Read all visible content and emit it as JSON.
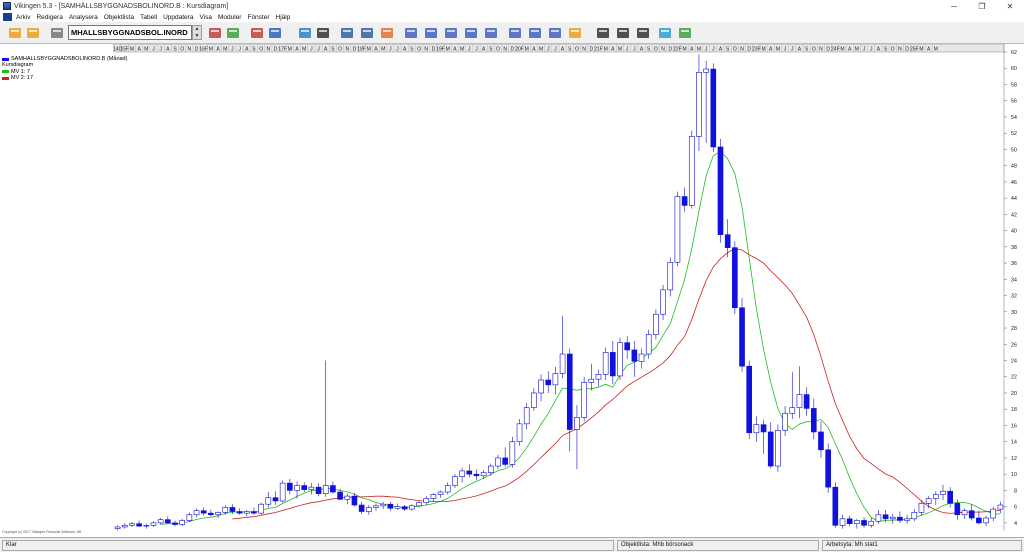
{
  "window": {
    "title": "Vikingen 5.3 - [SAMHÄLLSBYGGNADSBOLINORD.B : Kursdiagram]",
    "min_glyph": "─",
    "restore_glyph": "❐",
    "close_glyph": "✕"
  },
  "menu": [
    "Arkiv",
    "Redigera",
    "Analysera",
    "Objektlista",
    "Tabell",
    "Uppdatera",
    "Visa",
    "Moduler",
    "Fönster",
    "Hjälp"
  ],
  "toolbar": {
    "symbol_value": "MHALLSBYGGNADSBOL.INORD",
    "spin_up": "▲",
    "spin_down": "▼",
    "icons": [
      "open-folder-icon",
      "save-icon",
      "objectlist-icon",
      "next-icon",
      "prev-icon",
      "signal-icon",
      "info-icon",
      "refresh-icon",
      "camera-icon",
      "print-icon",
      "printer-icon",
      "color-icon",
      "window1-icon",
      "window2-icon",
      "window3-icon",
      "window4-icon",
      "grid-icon",
      "window5-icon",
      "window6-icon",
      "table-icon",
      "edit-icon",
      "candle-icon",
      "bars-icon",
      "curve-icon",
      "globe-icon",
      "module-icon"
    ]
  },
  "legend": [
    {
      "label": "SAMHALLSBYGGNADSBOLINORD.B (Månad)",
      "color": "#1010e0"
    },
    {
      "label": "Kursdiagram",
      "color": ""
    },
    {
      "label": "MV 1: 7",
      "color": "#22bb22"
    },
    {
      "label": "MV 2: 17",
      "color": "#cc2222"
    }
  ],
  "copyright": "Copyright (c) 2017 Vikingen Financial Software, AB",
  "status": {
    "left": "Klar",
    "objectlist": "Objektlista: Mhb börsonack",
    "worksheet": "Arbetsyta: Mh stat1"
  },
  "chart_data": {
    "type": "candlestick",
    "timeframe": "monthly",
    "ylim": [
      3,
      62
    ],
    "y_ticks": [
      4,
      6,
      8,
      10,
      12,
      14,
      16,
      18,
      20,
      22,
      24,
      26,
      28,
      30,
      32,
      34,
      36,
      38,
      40,
      42,
      44,
      46,
      48,
      50,
      52,
      54,
      56,
      58,
      60,
      62
    ],
    "x_axis_labels": [
      "14D",
      "15F",
      "M",
      "A",
      "M",
      "J",
      "J",
      "A",
      "S",
      "O",
      "N",
      "D",
      "16F",
      "M",
      "A",
      "M",
      "J",
      "J",
      "A",
      "S",
      "O",
      "N",
      "D",
      "17F",
      "M",
      "A",
      "M",
      "J",
      "J",
      "A",
      "S",
      "O",
      "N",
      "D",
      "18F",
      "M",
      "A",
      "M",
      "J",
      "J",
      "A",
      "S",
      "O",
      "N",
      "D",
      "19F",
      "M",
      "A",
      "M",
      "J",
      "J",
      "A",
      "S",
      "O",
      "N",
      "D",
      "20F",
      "M",
      "A",
      "M",
      "J",
      "J",
      "A",
      "S",
      "O",
      "N",
      "D",
      "21F",
      "M",
      "A",
      "M",
      "J",
      "J",
      "A",
      "S",
      "O",
      "N",
      "D",
      "22F",
      "M",
      "A",
      "M",
      "J",
      "J",
      "A",
      "S",
      "O",
      "N",
      "D",
      "23F",
      "M",
      "A",
      "M",
      "J",
      "J",
      "A",
      "S",
      "O",
      "N",
      "D",
      "24F",
      "M",
      "A",
      "M",
      "J",
      "J",
      "A",
      "S",
      "O",
      "N",
      "D",
      "25F",
      "M",
      "A",
      "M"
    ],
    "candles": [
      {
        "o": 3.3,
        "h": 3.7,
        "l": 3.1,
        "c": 3.5
      },
      {
        "o": 3.5,
        "h": 4.0,
        "l": 3.3,
        "c": 3.7
      },
      {
        "o": 3.7,
        "h": 4.1,
        "l": 3.5,
        "c": 3.9
      },
      {
        "o": 3.9,
        "h": 4.3,
        "l": 3.5,
        "c": 3.6
      },
      {
        "o": 3.6,
        "h": 3.9,
        "l": 3.3,
        "c": 3.7
      },
      {
        "o": 3.7,
        "h": 4.2,
        "l": 3.5,
        "c": 4.0
      },
      {
        "o": 4.0,
        "h": 4.6,
        "l": 3.8,
        "c": 4.4
      },
      {
        "o": 4.4,
        "h": 4.8,
        "l": 3.9,
        "c": 4.0
      },
      {
        "o": 4.0,
        "h": 4.3,
        "l": 3.6,
        "c": 3.8
      },
      {
        "o": 3.8,
        "h": 4.5,
        "l": 3.6,
        "c": 4.3
      },
      {
        "o": 4.3,
        "h": 5.3,
        "l": 4.1,
        "c": 5.0
      },
      {
        "o": 5.0,
        "h": 5.8,
        "l": 4.7,
        "c": 5.5
      },
      {
        "o": 5.5,
        "h": 5.9,
        "l": 4.9,
        "c": 5.2
      },
      {
        "o": 5.2,
        "h": 5.6,
        "l": 4.8,
        "c": 5.0
      },
      {
        "o": 5.0,
        "h": 5.4,
        "l": 4.6,
        "c": 5.3
      },
      {
        "o": 5.3,
        "h": 6.2,
        "l": 5.0,
        "c": 5.9
      },
      {
        "o": 5.9,
        "h": 6.3,
        "l": 5.1,
        "c": 5.4
      },
      {
        "o": 5.4,
        "h": 5.8,
        "l": 5.0,
        "c": 5.2
      },
      {
        "o": 5.2,
        "h": 5.6,
        "l": 4.8,
        "c": 5.4
      },
      {
        "o": 5.4,
        "h": 5.9,
        "l": 5.0,
        "c": 5.2
      },
      {
        "o": 5.2,
        "h": 6.5,
        "l": 5.0,
        "c": 6.3
      },
      {
        "o": 6.3,
        "h": 7.8,
        "l": 5.9,
        "c": 7.1
      },
      {
        "o": 7.1,
        "h": 7.9,
        "l": 6.2,
        "c": 6.7
      },
      {
        "o": 6.7,
        "h": 9.2,
        "l": 6.5,
        "c": 8.9
      },
      {
        "o": 8.9,
        "h": 9.4,
        "l": 7.5,
        "c": 8.0
      },
      {
        "o": 8.0,
        "h": 9.1,
        "l": 7.0,
        "c": 8.6
      },
      {
        "o": 8.6,
        "h": 9.0,
        "l": 7.8,
        "c": 8.1
      },
      {
        "o": 8.1,
        "h": 8.9,
        "l": 7.5,
        "c": 8.4
      },
      {
        "o": 8.4,
        "h": 8.9,
        "l": 7.3,
        "c": 7.6
      },
      {
        "o": 7.6,
        "h": 24.0,
        "l": 7.2,
        "c": 8.6
      },
      {
        "o": 8.6,
        "h": 9.1,
        "l": 7.6,
        "c": 7.8
      },
      {
        "o": 7.8,
        "h": 8.2,
        "l": 6.8,
        "c": 6.9
      },
      {
        "o": 6.9,
        "h": 7.6,
        "l": 6.3,
        "c": 7.3
      },
      {
        "o": 7.3,
        "h": 7.7,
        "l": 6.0,
        "c": 6.2
      },
      {
        "o": 6.2,
        "h": 6.6,
        "l": 5.1,
        "c": 5.4
      },
      {
        "o": 5.4,
        "h": 6.2,
        "l": 5.0,
        "c": 5.9
      },
      {
        "o": 5.9,
        "h": 6.4,
        "l": 5.5,
        "c": 6.1
      },
      {
        "o": 6.1,
        "h": 6.6,
        "l": 5.7,
        "c": 6.3
      },
      {
        "o": 6.3,
        "h": 6.6,
        "l": 5.5,
        "c": 5.8
      },
      {
        "o": 5.8,
        "h": 6.4,
        "l": 5.6,
        "c": 6.0
      },
      {
        "o": 6.0,
        "h": 6.2,
        "l": 5.5,
        "c": 5.7
      },
      {
        "o": 5.7,
        "h": 6.3,
        "l": 5.5,
        "c": 6.1
      },
      {
        "o": 6.1,
        "h": 6.7,
        "l": 5.9,
        "c": 6.5
      },
      {
        "o": 6.5,
        "h": 7.3,
        "l": 6.2,
        "c": 7.0
      },
      {
        "o": 7.0,
        "h": 7.7,
        "l": 6.6,
        "c": 7.5
      },
      {
        "o": 7.5,
        "h": 8.0,
        "l": 7.1,
        "c": 7.8
      },
      {
        "o": 7.8,
        "h": 9.0,
        "l": 7.5,
        "c": 8.6
      },
      {
        "o": 8.6,
        "h": 10.0,
        "l": 8.3,
        "c": 9.7
      },
      {
        "o": 9.7,
        "h": 10.8,
        "l": 9.0,
        "c": 10.4
      },
      {
        "o": 10.4,
        "h": 11.2,
        "l": 9.6,
        "c": 10.0
      },
      {
        "o": 10.0,
        "h": 10.6,
        "l": 9.3,
        "c": 9.8
      },
      {
        "o": 9.8,
        "h": 10.5,
        "l": 9.4,
        "c": 10.2
      },
      {
        "o": 10.2,
        "h": 11.3,
        "l": 9.8,
        "c": 11.0
      },
      {
        "o": 11.0,
        "h": 12.4,
        "l": 10.6,
        "c": 12.0
      },
      {
        "o": 12.0,
        "h": 13.3,
        "l": 10.9,
        "c": 11.2
      },
      {
        "o": 11.2,
        "h": 14.6,
        "l": 10.8,
        "c": 14.0
      },
      {
        "o": 14.0,
        "h": 16.8,
        "l": 13.5,
        "c": 16.2
      },
      {
        "o": 16.2,
        "h": 18.8,
        "l": 15.5,
        "c": 18.2
      },
      {
        "o": 18.2,
        "h": 20.6,
        "l": 17.8,
        "c": 20.0
      },
      {
        "o": 20.0,
        "h": 22.3,
        "l": 19.0,
        "c": 21.6
      },
      {
        "o": 21.6,
        "h": 22.7,
        "l": 20.0,
        "c": 21.0
      },
      {
        "o": 21.0,
        "h": 23.2,
        "l": 19.8,
        "c": 22.4
      },
      {
        "o": 22.4,
        "h": 29.5,
        "l": 21.8,
        "c": 24.8
      },
      {
        "o": 24.8,
        "h": 25.5,
        "l": 12.8,
        "c": 15.5
      },
      {
        "o": 15.5,
        "h": 18.5,
        "l": 10.6,
        "c": 17.0
      },
      {
        "o": 17.0,
        "h": 22.0,
        "l": 16.5,
        "c": 21.3
      },
      {
        "o": 21.3,
        "h": 23.6,
        "l": 20.3,
        "c": 21.7
      },
      {
        "o": 21.7,
        "h": 22.9,
        "l": 20.8,
        "c": 22.3
      },
      {
        "o": 22.3,
        "h": 25.6,
        "l": 21.6,
        "c": 25.0
      },
      {
        "o": 25.0,
        "h": 26.4,
        "l": 21.1,
        "c": 22.1
      },
      {
        "o": 22.1,
        "h": 26.8,
        "l": 21.6,
        "c": 26.2
      },
      {
        "o": 26.2,
        "h": 27.0,
        "l": 24.2,
        "c": 25.3
      },
      {
        "o": 25.3,
        "h": 26.4,
        "l": 22.0,
        "c": 23.9
      },
      {
        "o": 23.9,
        "h": 25.5,
        "l": 23.0,
        "c": 24.8
      },
      {
        "o": 24.8,
        "h": 27.8,
        "l": 24.2,
        "c": 27.2
      },
      {
        "o": 27.2,
        "h": 30.3,
        "l": 26.6,
        "c": 29.7
      },
      {
        "o": 29.7,
        "h": 33.3,
        "l": 29.0,
        "c": 32.7
      },
      {
        "o": 32.7,
        "h": 36.7,
        "l": 31.9,
        "c": 36.1
      },
      {
        "o": 36.1,
        "h": 44.8,
        "l": 35.6,
        "c": 44.2
      },
      {
        "o": 44.2,
        "h": 45.3,
        "l": 42.3,
        "c": 43.1
      },
      {
        "o": 43.1,
        "h": 52.3,
        "l": 42.7,
        "c": 51.6
      },
      {
        "o": 51.6,
        "h": 61.7,
        "l": 49.8,
        "c": 59.5
      },
      {
        "o": 59.5,
        "h": 60.9,
        "l": 50.8,
        "c": 59.9
      },
      {
        "o": 59.9,
        "h": 60.6,
        "l": 49.7,
        "c": 50.3
      },
      {
        "o": 50.3,
        "h": 51.3,
        "l": 38.5,
        "c": 39.5
      },
      {
        "o": 39.5,
        "h": 41.4,
        "l": 36.7,
        "c": 37.9
      },
      {
        "o": 37.9,
        "h": 38.7,
        "l": 29.7,
        "c": 30.5
      },
      {
        "o": 30.5,
        "h": 31.7,
        "l": 22.6,
        "c": 23.3
      },
      {
        "o": 23.3,
        "h": 24.0,
        "l": 14.3,
        "c": 15.1
      },
      {
        "o": 15.1,
        "h": 17.1,
        "l": 14.0,
        "c": 16.1
      },
      {
        "o": 16.1,
        "h": 16.7,
        "l": 12.5,
        "c": 15.2
      },
      {
        "o": 15.2,
        "h": 16.4,
        "l": 10.7,
        "c": 11.0
      },
      {
        "o": 11.0,
        "h": 16.1,
        "l": 10.3,
        "c": 15.4
      },
      {
        "o": 15.4,
        "h": 18.4,
        "l": 14.7,
        "c": 17.5
      },
      {
        "o": 17.5,
        "h": 22.6,
        "l": 16.8,
        "c": 18.2
      },
      {
        "o": 18.2,
        "h": 23.3,
        "l": 16.9,
        "c": 19.8
      },
      {
        "o": 19.8,
        "h": 20.7,
        "l": 17.2,
        "c": 18.1
      },
      {
        "o": 18.1,
        "h": 19.3,
        "l": 14.3,
        "c": 15.2
      },
      {
        "o": 15.2,
        "h": 16.5,
        "l": 12.0,
        "c": 13.0
      },
      {
        "o": 13.0,
        "h": 13.8,
        "l": 7.7,
        "c": 8.4
      },
      {
        "o": 8.4,
        "h": 9.0,
        "l": 3.4,
        "c": 3.7
      },
      {
        "o": 3.7,
        "h": 5.0,
        "l": 3.3,
        "c": 4.5
      },
      {
        "o": 4.5,
        "h": 4.9,
        "l": 3.6,
        "c": 3.9
      },
      {
        "o": 3.9,
        "h": 4.5,
        "l": 3.3,
        "c": 4.3
      },
      {
        "o": 4.3,
        "h": 4.7,
        "l": 3.4,
        "c": 3.7
      },
      {
        "o": 3.7,
        "h": 4.6,
        "l": 3.4,
        "c": 4.2
      },
      {
        "o": 4.2,
        "h": 5.6,
        "l": 3.9,
        "c": 5.0
      },
      {
        "o": 5.0,
        "h": 5.6,
        "l": 4.1,
        "c": 4.5
      },
      {
        "o": 4.5,
        "h": 5.1,
        "l": 3.9,
        "c": 4.7
      },
      {
        "o": 4.7,
        "h": 5.4,
        "l": 4.0,
        "c": 4.3
      },
      {
        "o": 4.3,
        "h": 5.0,
        "l": 3.9,
        "c": 4.5
      },
      {
        "o": 4.5,
        "h": 5.7,
        "l": 4.2,
        "c": 5.3
      },
      {
        "o": 5.3,
        "h": 6.8,
        "l": 4.9,
        "c": 6.4
      },
      {
        "o": 6.4,
        "h": 7.3,
        "l": 5.8,
        "c": 7.0
      },
      {
        "o": 7.0,
        "h": 7.9,
        "l": 6.2,
        "c": 7.5
      },
      {
        "o": 7.5,
        "h": 8.7,
        "l": 6.8,
        "c": 7.9
      },
      {
        "o": 7.9,
        "h": 8.4,
        "l": 5.9,
        "c": 6.4
      },
      {
        "o": 6.4,
        "h": 6.9,
        "l": 4.4,
        "c": 5.0
      },
      {
        "o": 5.0,
        "h": 5.8,
        "l": 4.5,
        "c": 5.5
      },
      {
        "o": 5.5,
        "h": 6.3,
        "l": 4.3,
        "c": 4.6
      },
      {
        "o": 4.6,
        "h": 5.5,
        "l": 3.8,
        "c": 4.0
      },
      {
        "o": 4.0,
        "h": 4.9,
        "l": 3.6,
        "c": 4.6
      },
      {
        "o": 4.6,
        "h": 6.0,
        "l": 4.2,
        "c": 5.7
      },
      {
        "o": 5.7,
        "h": 6.6,
        "l": 5.2,
        "c": 6.2
      }
    ],
    "ma_periods": [
      7,
      17
    ],
    "ma_colors": [
      "#22bb22",
      "#cc2222"
    ]
  }
}
